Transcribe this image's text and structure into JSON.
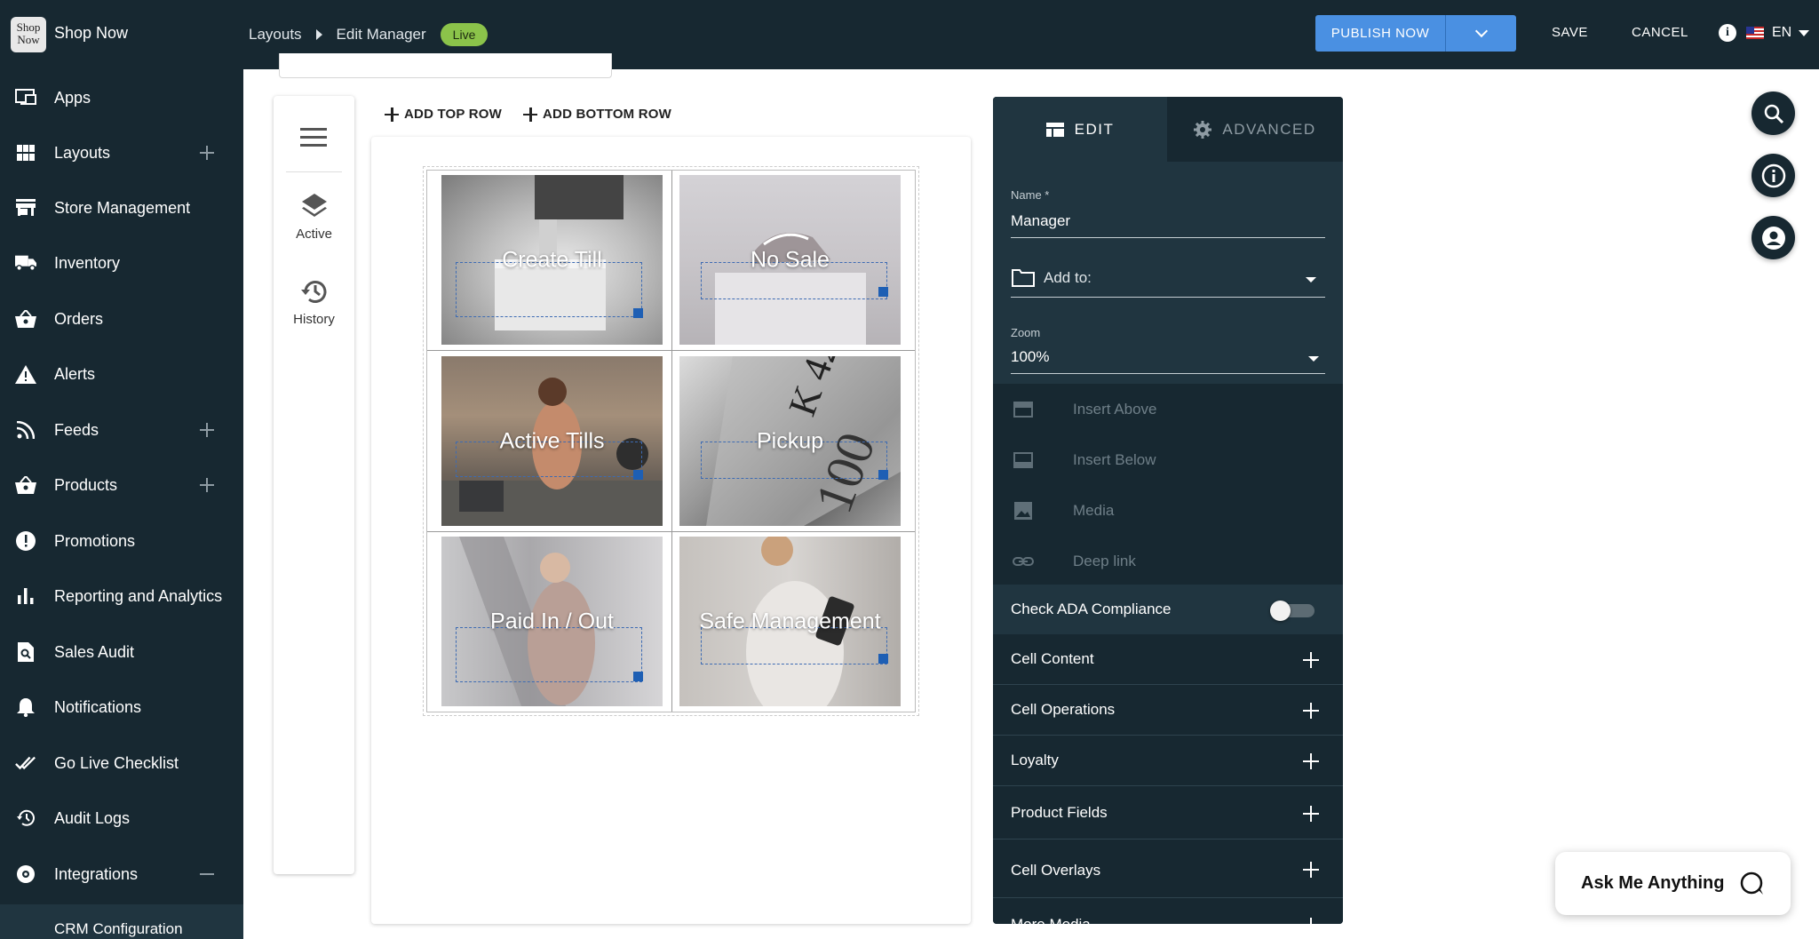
{
  "app": {
    "logo_text": "Shop Now",
    "name": "Shop Now"
  },
  "breadcrumb": {
    "parent": "Layouts",
    "current": "Edit Manager",
    "status": "Live"
  },
  "toolbar": {
    "publish_label": "PUBLISH NOW",
    "save_label": "SAVE",
    "cancel_label": "CANCEL",
    "language": "EN"
  },
  "sidebar": {
    "items": [
      {
        "label": "Apps",
        "icon": "monitor-icon"
      },
      {
        "label": "Layouts",
        "icon": "grid-icon",
        "expand": "plus"
      },
      {
        "label": "Store Management",
        "icon": "store-icon"
      },
      {
        "label": "Inventory",
        "icon": "truck-icon"
      },
      {
        "label": "Orders",
        "icon": "basket-icon"
      },
      {
        "label": "Alerts",
        "icon": "warning-icon"
      },
      {
        "label": "Feeds",
        "icon": "rss-icon",
        "expand": "plus"
      },
      {
        "label": "Products",
        "icon": "basket-icon",
        "expand": "plus"
      },
      {
        "label": "Promotions",
        "icon": "badge-alert-icon"
      },
      {
        "label": "Reporting and Analytics",
        "icon": "bar-chart-icon"
      },
      {
        "label": "Sales Audit",
        "icon": "file-search-icon"
      },
      {
        "label": "Notifications",
        "icon": "bell-icon"
      },
      {
        "label": "Go Live Checklist",
        "icon": "check-all-icon"
      },
      {
        "label": "Audit Logs",
        "icon": "history-icon"
      },
      {
        "label": "Integrations",
        "icon": "cog-icon",
        "expand": "minus"
      }
    ],
    "sub_item": "CRM Configuration"
  },
  "tools": {
    "active_label": "Active",
    "history_label": "History"
  },
  "canvas": {
    "add_top_row": "ADD TOP ROW",
    "add_bottom_row": "ADD BOTTOM ROW",
    "cells": [
      {
        "label": "Create Till"
      },
      {
        "label": "No Sale"
      },
      {
        "label": "Active Tills"
      },
      {
        "label": "Pickup"
      },
      {
        "label": "Paid In / Out"
      },
      {
        "label": "Safe Management"
      }
    ]
  },
  "panel": {
    "tab_edit": "EDIT",
    "tab_advanced": "ADVANCED",
    "name_label": "Name *",
    "name_value": "Manager",
    "add_to_placeholder": "Add to:",
    "zoom_label": "Zoom",
    "zoom_value": "100%",
    "insert_actions": [
      "Insert Above",
      "Insert Below",
      "Media",
      "Deep link"
    ],
    "ada_label": "Check ADA Compliance",
    "ada_enabled": false,
    "sections": [
      "Cell Content",
      "Cell Operations",
      "Loyalty",
      "Product Fields",
      "Cell Overlays",
      "More Media"
    ]
  },
  "assistant": {
    "label": "Ask Me Anything"
  },
  "colors": {
    "dark": "#172831",
    "panel": "#203540",
    "accent": "#4a90e2",
    "live": "#8bc34a"
  }
}
